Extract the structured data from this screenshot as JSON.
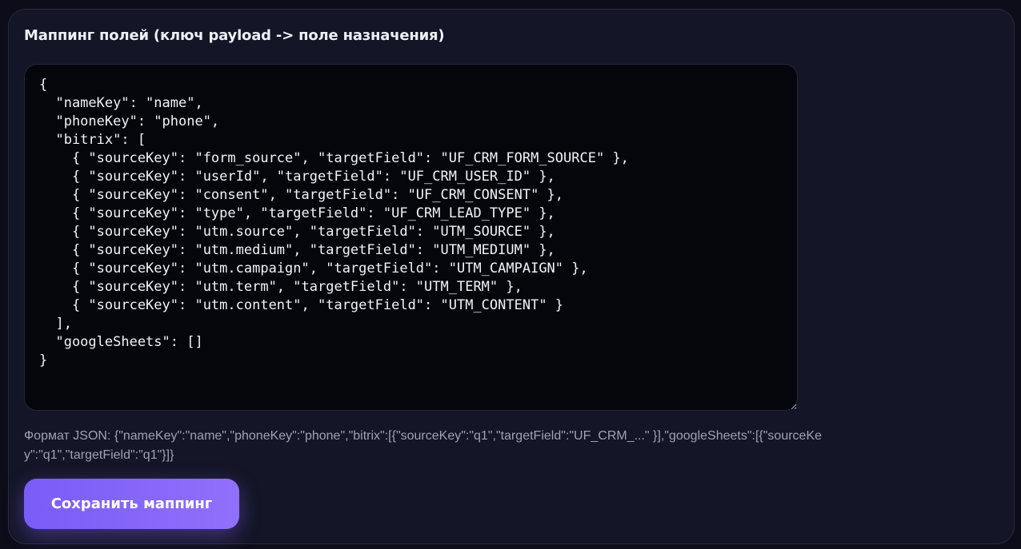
{
  "mapping_section": {
    "title": "Маппинг полей (ключ payload -> поле назначения)",
    "editor_value": "{\n  \"nameKey\": \"name\",\n  \"phoneKey\": \"phone\",\n  \"bitrix\": [\n    { \"sourceKey\": \"form_source\", \"targetField\": \"UF_CRM_FORM_SOURCE\" },\n    { \"sourceKey\": \"userId\", \"targetField\": \"UF_CRM_USER_ID\" },\n    { \"sourceKey\": \"consent\", \"targetField\": \"UF_CRM_CONSENT\" },\n    { \"sourceKey\": \"type\", \"targetField\": \"UF_CRM_LEAD_TYPE\" },\n    { \"sourceKey\": \"utm.source\", \"targetField\": \"UTM_SOURCE\" },\n    { \"sourceKey\": \"utm.medium\", \"targetField\": \"UTM_MEDIUM\" },\n    { \"sourceKey\": \"utm.campaign\", \"targetField\": \"UTM_CAMPAIGN\" },\n    { \"sourceKey\": \"utm.term\", \"targetField\": \"UTM_TERM\" },\n    { \"sourceKey\": \"utm.content\", \"targetField\": \"UTM_CONTENT\" }\n  ],\n  \"googleSheets\": []\n}",
    "hint": "Формат JSON: {\"nameKey\":\"name\",\"phoneKey\":\"phone\",\"bitrix\":[{\"sourceKey\":\"q1\",\"targetField\":\"UF_CRM_...\" }],\"googleSheets\":[{\"sourceKey\":\"q1\",\"targetField\":\"q1\"}]}",
    "save_label": "Сохранить маппинг"
  },
  "colors": {
    "background": "#0c0d18",
    "card": "#141526",
    "editor": "#05060c",
    "accent": "#8065f8",
    "hint_text": "#9ea2b6"
  }
}
